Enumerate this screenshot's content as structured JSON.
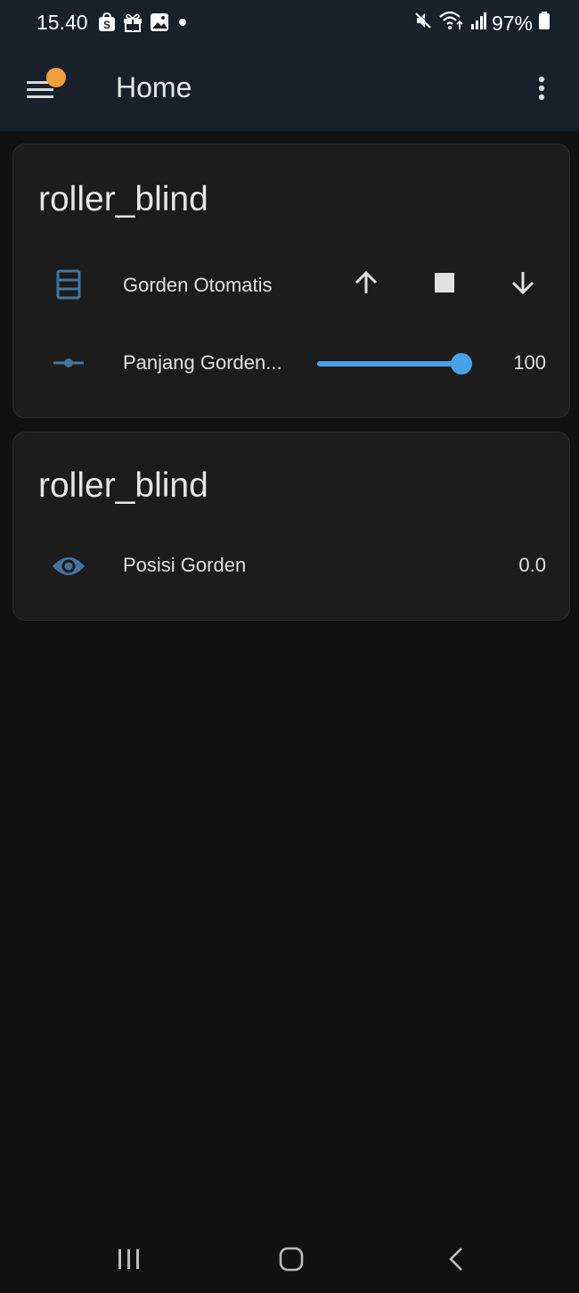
{
  "status_bar": {
    "time": "15.40",
    "battery": "97%",
    "icons": [
      "shopee-icon",
      "gift-icon",
      "gallery-icon",
      "notification-dot-icon",
      "mute-icon",
      "wifi-icon",
      "signal-icon",
      "battery-icon"
    ]
  },
  "header": {
    "title": "Home",
    "menu_icon": "hamburger-menu-icon",
    "menu_badge_color": "#f3a13b",
    "overflow_icon": "more-vert-icon"
  },
  "cards": [
    {
      "title": "roller_blind",
      "rows": [
        {
          "icon": "window-shutter-icon",
          "label": "Gorden Otomatis",
          "controls": [
            "arrow-up-icon",
            "stop-icon",
            "arrow-down-icon"
          ]
        },
        {
          "icon": "ray-vertex-icon",
          "label": "Panjang Gorden...",
          "slider_value": 100,
          "slider_min": 0,
          "slider_max": 100,
          "value": "100"
        }
      ]
    },
    {
      "title": "roller_blind",
      "rows": [
        {
          "icon": "eye-icon",
          "label": "Posisi Gorden",
          "value": "0.0"
        }
      ]
    }
  ],
  "colors": {
    "accent": "#46a1e8",
    "state_icon": "#44739e",
    "header_bg": "#18202a",
    "card_bg": "#1c1c1c"
  },
  "nav_bar": {
    "icons": [
      "recent-apps-icon",
      "home-icon",
      "back-icon"
    ]
  }
}
